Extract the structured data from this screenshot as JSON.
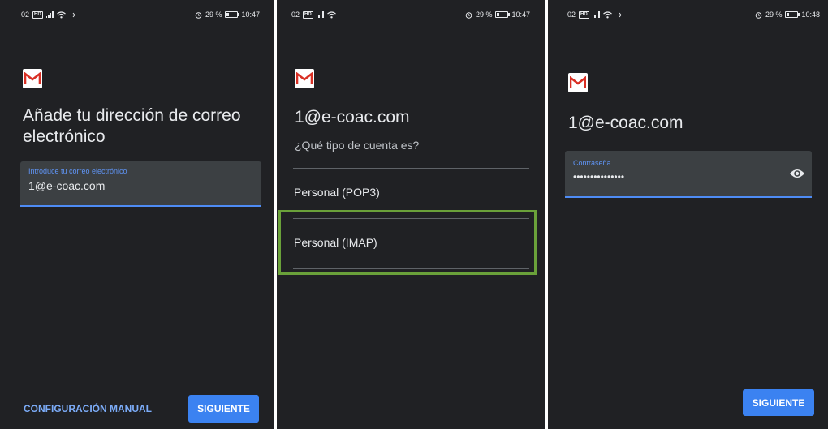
{
  "screens": [
    {
      "status": {
        "net": "02",
        "badge": "HD",
        "battery": "29 %",
        "time": "10:47"
      },
      "title": "Añade tu dirección de correo electrónico",
      "input": {
        "label": "Introduce tu correo electrónico",
        "value": "1@e-coac.com"
      },
      "manual_label": "CONFIGURACIÓN MANUAL",
      "next_label": "SIGUIENTE"
    },
    {
      "status": {
        "net": "02",
        "badge": "HD",
        "battery": "29 %",
        "time": "10:47"
      },
      "title": "1@e-coac.com",
      "subtitle": "¿Qué tipo de cuenta es?",
      "options": [
        "Personal (POP3)",
        "Personal (IMAP)"
      ],
      "highlighted_option": "Personal (IMAP)",
      "highlight_color": "#6aa13a"
    },
    {
      "status": {
        "net": "02",
        "badge": "HD",
        "battery": "29 %",
        "time": "10:48"
      },
      "title": "1@e-coac.com",
      "password": {
        "label": "Contraseña",
        "value": "•••••••••••••••"
      },
      "next_label": "SIGUIENTE"
    }
  ],
  "colors": {
    "background": "#202124",
    "accent": "#3b82f1",
    "field": "#3c4043"
  },
  "icons": {
    "logo": "gmail-logo-icon",
    "eye": "eye-icon"
  }
}
